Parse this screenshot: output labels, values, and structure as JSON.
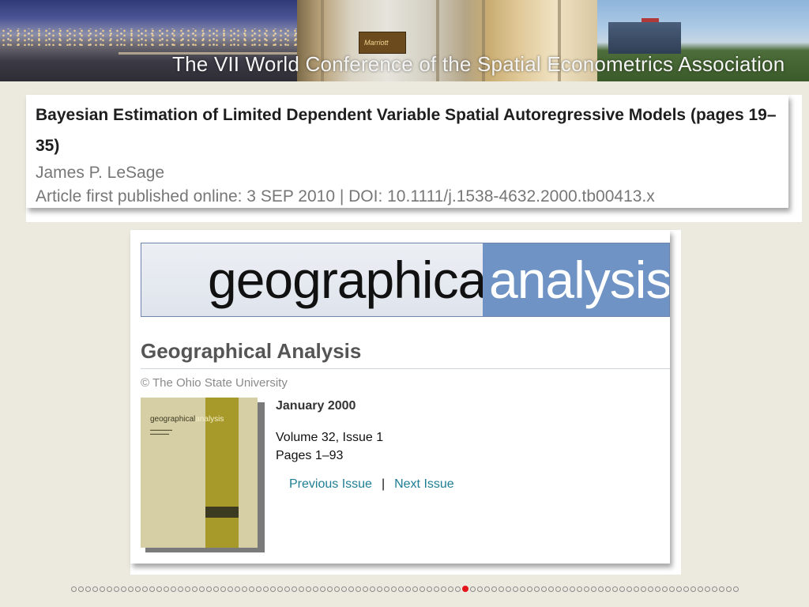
{
  "banner": {
    "title": "The VII World Conference of the Spatial Econometrics Association",
    "podium_logo": "Marriott"
  },
  "article": {
    "title": "Bayesian Estimation of Limited Dependent Variable Spatial Autoregressive Models (pages 19–35)",
    "author": "James P. LeSage",
    "meta": "Article first published online: 3 SEP 2010 | DOI: 10.1111/j.1538-4632.2000.tb00413.x"
  },
  "journal": {
    "banner_word1": "geographical",
    "banner_word2": "analysis",
    "heading": "Geographical Analysis",
    "copyright": "© The Ohio State University",
    "cover": {
      "title_part1": "geographical",
      "title_part2": "analysis"
    },
    "issue": {
      "date": "January 2000",
      "volume": "Volume 32, Issue 1",
      "pages": "Pages 1–93"
    },
    "nav": {
      "previous": "Previous Issue",
      "separator": "|",
      "next": "Next Issue"
    }
  },
  "slide_navigator": {
    "total": 94,
    "current": 56
  },
  "colors": {
    "background": "#ece9df",
    "journal_blue": "#6f93c4",
    "link": "#1e7e94",
    "active_dot": "#e3141c"
  }
}
